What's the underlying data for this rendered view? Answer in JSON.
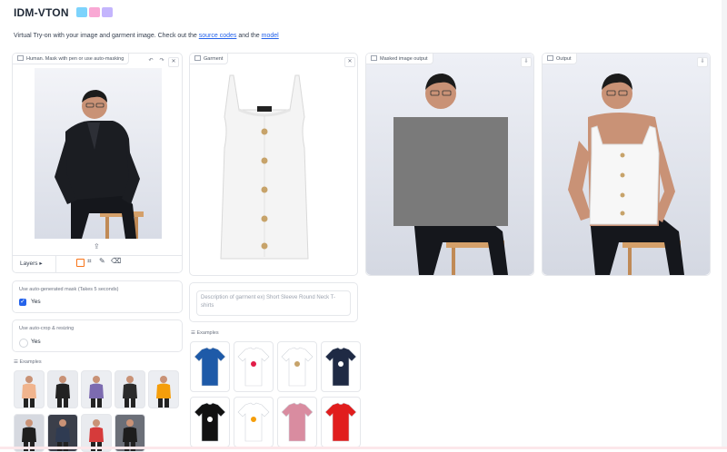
{
  "app": {
    "title": "IDM-VTON",
    "emoji_colors": [
      "#7dd3fc",
      "#f9a8d4",
      "#c4b5fd"
    ],
    "description_prefix": "Virtual Try-on with your image and garment image. Check out the ",
    "source_link": "source codes",
    "description_middle": " and the ",
    "model_link": "model"
  },
  "human_panel": {
    "label": "Human. Mask with pen or use auto-masking",
    "layers_label": "Layers"
  },
  "garment_panel": {
    "label": "Garment"
  },
  "masked_panel": {
    "label": "Masked image output"
  },
  "output_panel": {
    "label": "Output"
  },
  "auto_mask": {
    "label": "Use auto-generated mask (Takes 5 seconds)",
    "option": "Yes",
    "checked": true
  },
  "auto_crop": {
    "label": "Use auto-crop & resizing",
    "option": "Yes",
    "checked": false
  },
  "garment_description": {
    "text": "Description of garment ex) Short Sleeve Round Neck T-shirts"
  },
  "human_examples": {
    "label": "Examples",
    "items": [
      "human-example-1",
      "human-example-2",
      "human-example-3",
      "human-example-4",
      "human-example-5",
      "human-example-6",
      "human-example-7",
      "human-example-8",
      "human-example-9"
    ]
  },
  "garment_examples": {
    "label": "Examples",
    "items": [
      "garment-example-1",
      "garment-example-2",
      "garment-example-3",
      "garment-example-4",
      "garment-example-5",
      "garment-example-6",
      "garment-example-7",
      "garment-example-8"
    ]
  },
  "colors": {
    "accent": "#f97316",
    "link": "#2563eb",
    "checkbox": "#2563eb",
    "mask_gray": "#7a7a7a"
  }
}
